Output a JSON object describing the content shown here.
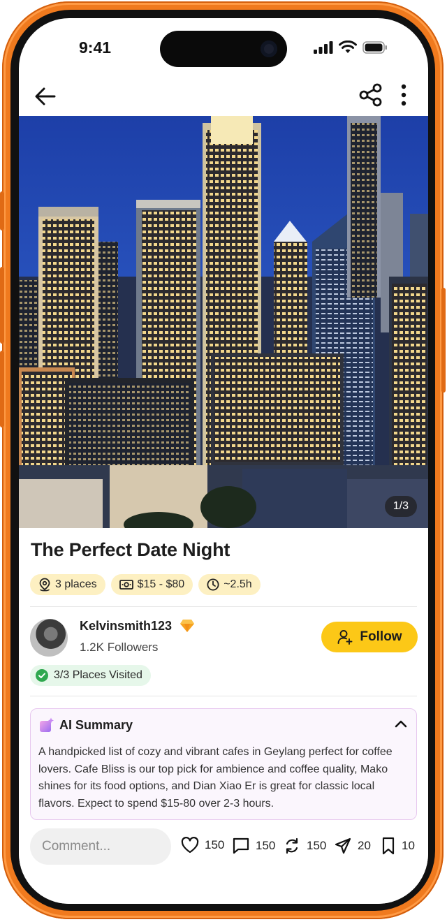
{
  "status_bar": {
    "time": "9:41"
  },
  "hero": {
    "pager": "1/3"
  },
  "post": {
    "title": "The Perfect Date Night",
    "chips": [
      {
        "icon": "location-pin-icon",
        "label": "3 places"
      },
      {
        "icon": "money-icon",
        "label": "$15 - $80"
      },
      {
        "icon": "clock-icon",
        "label": "~2.5h"
      }
    ]
  },
  "author": {
    "username": "Kelvinsmith123",
    "followers": "1.2K Followers",
    "follow_label": "Follow",
    "visited_label": "3/3 Places Visited"
  },
  "ai_summary": {
    "title": "AI Summary",
    "text": "A handpicked list of cozy and vibrant cafes in Geylang perfect for coffee lovers. Cafe Bliss is our top pick for ambience and coffee quality, Mako shines for its food options, and Dian Xiao Er is great for classic local flavors. Expect to spend $15-80 over 2-3 hours."
  },
  "bottom_bar": {
    "comment_placeholder": "Comment...",
    "likes": "150",
    "comments": "150",
    "reposts": "150",
    "shares": "20",
    "saves": "10"
  },
  "colors": {
    "accent_yellow": "#fcc817",
    "chip_bg": "#fdf0c2",
    "visited_green": "#2fa84f",
    "phone_frame": "#f07a1e"
  }
}
